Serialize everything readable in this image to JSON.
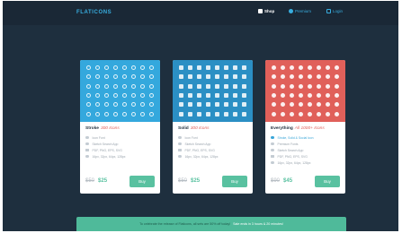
{
  "header": {
    "logo": "FLATICONS",
    "nav": [
      {
        "label": "Shop",
        "icon": "cart-icon"
      },
      {
        "label": "Premium",
        "icon": "star-icon"
      },
      {
        "label": "Login",
        "icon": "user-icon"
      }
    ]
  },
  "plans": [
    {
      "title": "Stroke",
      "count": "300 Icons",
      "color": "#34a8dd",
      "features": [
        "Icon Font",
        "Sketch Search App",
        "PDF, PNG, EPS, SVG",
        "16px, 32px, 64px, 128px"
      ],
      "old_price": "$50",
      "price": "$25",
      "button": "Buy"
    },
    {
      "title": "Solid",
      "count": "300 Icons",
      "color": "#2b8fc4",
      "features": [
        "Icon Font",
        "Sketch Search App",
        "PDF, PNG, EPS, SVG",
        "16px, 32px, 64px, 128px"
      ],
      "old_price": "$50",
      "price": "$25",
      "button": "Buy"
    },
    {
      "title": "Everything",
      "count": "All 1000+ Icons",
      "color": "#e0605a",
      "features": [
        "Stroke, Solid & Social Icon",
        "Premium Fonts",
        "Sketch Search App",
        "PDF, PNG, EPS, SVG",
        "16px, 32px, 64px, 128px"
      ],
      "old_price": "$90",
      "price": "$45",
      "button": "Buy"
    }
  ],
  "banner": {
    "text": "To celebrate the release of Flaticons, all sets are 50% off today!",
    "emphasis": "Sale ends in 3 hours & 20 minutes!"
  }
}
